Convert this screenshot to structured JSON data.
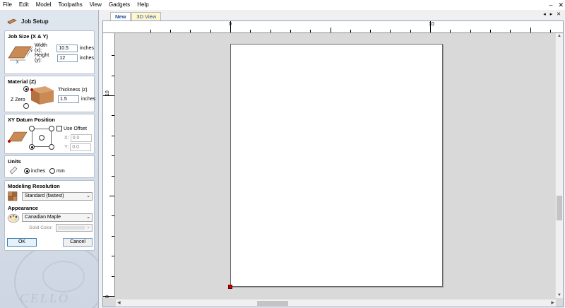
{
  "menu": [
    "File",
    "Edit",
    "Model",
    "Toolpaths",
    "View",
    "Gadgets",
    "Help"
  ],
  "window_controls": {
    "minimize": "–",
    "close": "✕"
  },
  "panel": {
    "title": "Job Setup",
    "job_size": {
      "title": "Job Size (X & Y)",
      "width_label": "Width (x):",
      "width_value": "10.5",
      "width_unit": "inches",
      "height_label": "Height (y):",
      "height_value": "12",
      "height_unit": "inches",
      "axis_x": "X",
      "axis_y": "Y"
    },
    "material": {
      "title": "Material (Z)",
      "thickness_label": "Thickness (z)",
      "thickness_value": "1.5",
      "thickness_unit": "inches",
      "z_zero_label": "Z Zero"
    },
    "datum": {
      "title": "XY Datum Position",
      "use_offset_label": "Use Offset",
      "x_label": "X:",
      "x_value": "0.0",
      "y_label": "Y:",
      "y_value": "0.0"
    },
    "units": {
      "title": "Units",
      "inches_label": "inches",
      "mm_label": "mm"
    },
    "resolution": {
      "title": "Modeling Resolution",
      "selected": "Standard (fastest)"
    },
    "appearance": {
      "title": "Appearance",
      "selected": "Canadian Maple",
      "solid_color_label": "Solid Color:"
    },
    "ok_label": "OK",
    "cancel_label": "Cancel",
    "watermark_text": "CELLO"
  },
  "tabs": [
    {
      "label": "New"
    },
    {
      "label": "3D View"
    }
  ],
  "tab_controls": "◂ ▸ ✕",
  "ruler": {
    "top_labels": [
      "0",
      "10"
    ],
    "left_labels": [
      "10",
      "0"
    ]
  },
  "colors": {
    "origin_marker": "#cc0000",
    "material_wood": "#c98a55",
    "tab_active_text": "#1f4e99"
  }
}
